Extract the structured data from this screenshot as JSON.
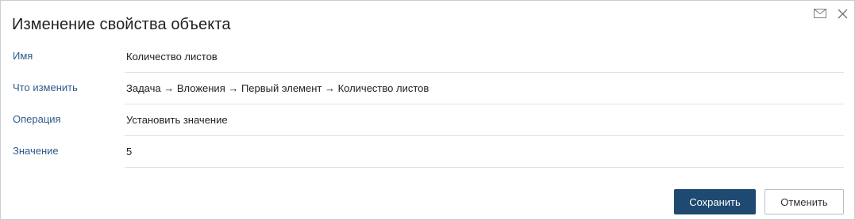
{
  "dialog": {
    "title": "Изменение свойства объекта"
  },
  "header_icons": [
    "mail-icon",
    "close-icon"
  ],
  "fields": [
    {
      "label": "Имя",
      "value": "Количество листов"
    },
    {
      "label": "Что изменить",
      "value": "Задача → Вложения → Первый элемент → Количество листов"
    },
    {
      "label": "Операция",
      "value": "Установить значение"
    },
    {
      "label": "Значение",
      "value": "5"
    }
  ],
  "buttons": {
    "save": "Сохранить",
    "cancel": "Отменить"
  },
  "colors": {
    "label": "#2e5b8a",
    "primary": "#1e4a72",
    "border": "#c9cdd2"
  }
}
